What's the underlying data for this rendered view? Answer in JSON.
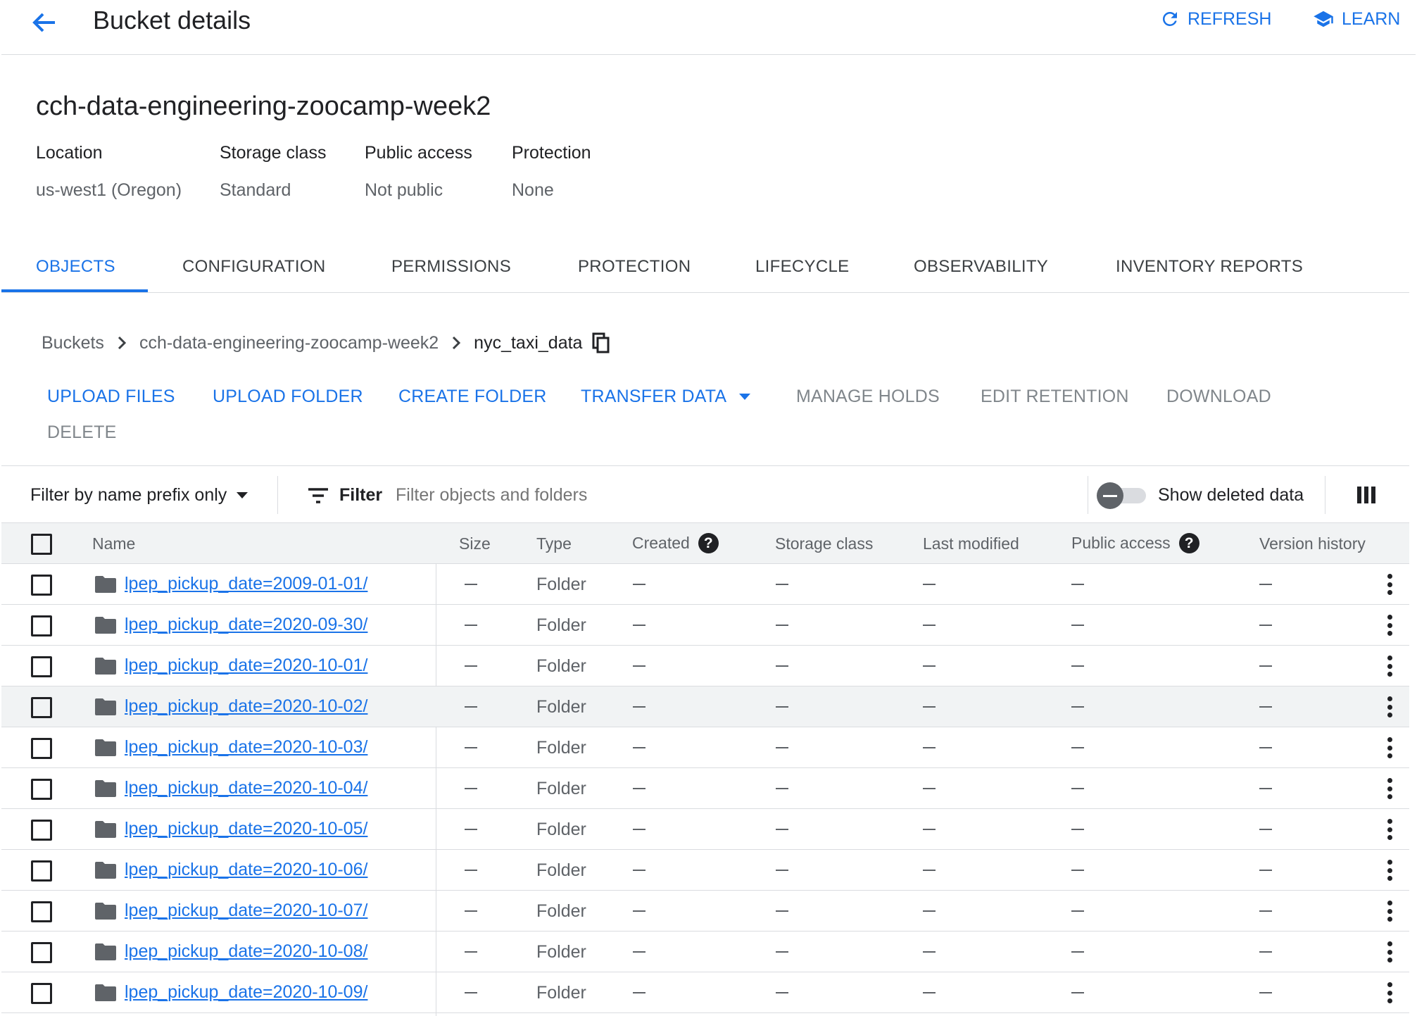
{
  "header": {
    "title": "Bucket details",
    "refresh_label": "REFRESH",
    "learn_label": "LEARN"
  },
  "bucket": {
    "name": "cch-data-engineering-zoocamp-week2",
    "meta": [
      {
        "key": "Location",
        "value": "us-west1 (Oregon)"
      },
      {
        "key": "Storage class",
        "value": "Standard"
      },
      {
        "key": "Public access",
        "value": "Not public"
      },
      {
        "key": "Protection",
        "value": "None"
      }
    ]
  },
  "tabs": [
    "OBJECTS",
    "CONFIGURATION",
    "PERMISSIONS",
    "PROTECTION",
    "LIFECYCLE",
    "OBSERVABILITY",
    "INVENTORY REPORTS"
  ],
  "breadcrumb": [
    "Buckets",
    "cch-data-engineering-zoocamp-week2",
    "nyc_taxi_data"
  ],
  "actions": {
    "upload_files": "UPLOAD FILES",
    "upload_folder": "UPLOAD FOLDER",
    "create_folder": "CREATE FOLDER",
    "transfer_data": "TRANSFER DATA",
    "manage_holds": "MANAGE HOLDS",
    "edit_retention": "EDIT RETENTION",
    "download": "DOWNLOAD",
    "delete": "DELETE"
  },
  "filter": {
    "mode": "Filter by name prefix only",
    "filter_label": "Filter",
    "placeholder": "Filter objects and folders",
    "show_deleted_label": "Show deleted data"
  },
  "table": {
    "headers": {
      "name": "Name",
      "size": "Size",
      "type": "Type",
      "created": "Created",
      "storage_class": "Storage class",
      "last_modified": "Last modified",
      "public_access": "Public access",
      "version_history": "Version history"
    },
    "rows": [
      {
        "name": "lpep_pickup_date=2009-01-01/",
        "type": "Folder"
      },
      {
        "name": "lpep_pickup_date=2020-09-30/",
        "type": "Folder"
      },
      {
        "name": "lpep_pickup_date=2020-10-01/",
        "type": "Folder"
      },
      {
        "name": "lpep_pickup_date=2020-10-02/",
        "type": "Folder"
      },
      {
        "name": "lpep_pickup_date=2020-10-03/",
        "type": "Folder"
      },
      {
        "name": "lpep_pickup_date=2020-10-04/",
        "type": "Folder"
      },
      {
        "name": "lpep_pickup_date=2020-10-05/",
        "type": "Folder"
      },
      {
        "name": "lpep_pickup_date=2020-10-06/",
        "type": "Folder"
      },
      {
        "name": "lpep_pickup_date=2020-10-07/",
        "type": "Folder"
      },
      {
        "name": "lpep_pickup_date=2020-10-08/",
        "type": "Folder"
      },
      {
        "name": "lpep_pickup_date=2020-10-09/",
        "type": "Folder"
      }
    ]
  },
  "colors": {
    "accent": "#1a73e8",
    "text": "#202124",
    "muted": "#5f6368"
  }
}
